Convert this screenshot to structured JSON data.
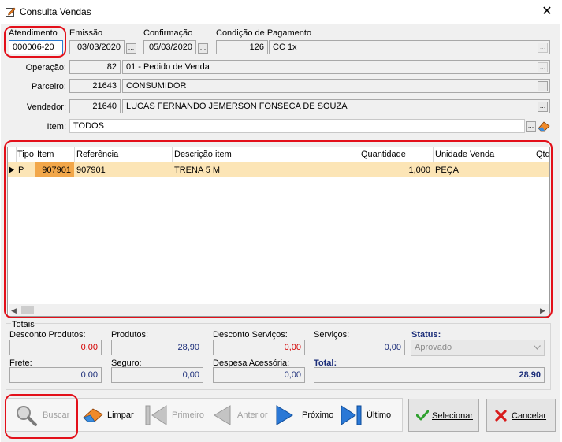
{
  "window": {
    "title": "Consulta Vendas",
    "close_glyph": "✕"
  },
  "header": {
    "atendimento_label": "Atendimento",
    "atendimento_value": "000006-20",
    "emissao_label": "Emissão",
    "emissao_value": "03/03/2020",
    "confirmacao_label": "Confirmação",
    "confirmacao_value": "05/03/2020",
    "condicao_label": "Condição de Pagamento",
    "condicao_code": "126",
    "condicao_desc": "CC 1x",
    "ellipsis": "..."
  },
  "fields": {
    "operacao_label": "Operação:",
    "operacao_code": "82",
    "operacao_desc": "01 - Pedido de Venda",
    "parceiro_label": "Parceiro:",
    "parceiro_code": "21643",
    "parceiro_desc": "CONSUMIDOR",
    "vendedor_label": "Vendedor:",
    "vendedor_code": "21640",
    "vendedor_desc": "LUCAS FERNANDO JEMERSON FONSECA DE SOUZA",
    "item_label": "Item:",
    "item_value": "TODOS"
  },
  "grid": {
    "columns": [
      "Tipo",
      "Item",
      "Referência",
      "Descrição item",
      "Quantidade",
      "Unidade Venda",
      "Qtd"
    ],
    "rows": [
      {
        "tipo": "P",
        "item": "907901",
        "referencia": "907901",
        "descricao": "TRENA 5 M",
        "quantidade": "1,000",
        "unidade": "PEÇA",
        "qtd": ""
      }
    ]
  },
  "totals": {
    "section_label": "Totais",
    "desconto_produtos_label": "Desconto Produtos:",
    "desconto_produtos_value": "0,00",
    "produtos_label": "Produtos:",
    "produtos_value": "28,90",
    "desconto_servicos_label": "Desconto Serviços:",
    "desconto_servicos_value": "0,00",
    "servicos_label": "Serviços:",
    "servicos_value": "0,00",
    "status_label": "Status:",
    "status_value": "Aprovado",
    "frete_label": "Frete:",
    "frete_value": "0,00",
    "seguro_label": "Seguro:",
    "seguro_value": "0,00",
    "despesa_label": "Despesa Acessória:",
    "despesa_value": "0,00",
    "total_label": "Total:",
    "total_value": "28,90"
  },
  "nav": {
    "buscar": "Buscar",
    "limpar": "Limpar",
    "primeiro": "Primeiro",
    "anterior": "Anterior",
    "proximo": "Próximo",
    "ultimo": "Último"
  },
  "actions": {
    "selecionar": "Selecionar",
    "cancelar": "Cancelar"
  },
  "colors": {
    "red_money": "#d40000",
    "blue_money": "#1c2e7a",
    "row_highlight": "#fce5b6",
    "item_cell": "#f2a74a",
    "annotation_red": "#e3101a"
  }
}
